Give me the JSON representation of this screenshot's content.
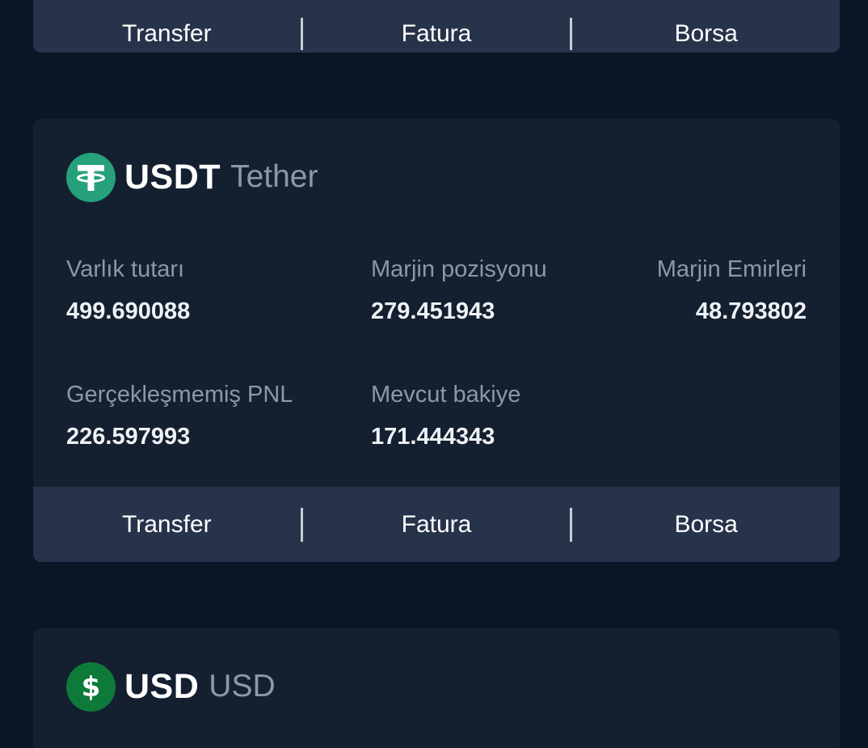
{
  "top_card": {
    "actions": {
      "transfer": "Transfer",
      "invoice": "Fatura",
      "exchange": "Borsa"
    }
  },
  "usdt_card": {
    "symbol": "USDT",
    "name": "Tether",
    "icon": "tether-icon",
    "icon_color": "#26a17b",
    "stats": {
      "asset_amount": {
        "label": "Varlık tutarı",
        "value": "499.690088"
      },
      "margin_position": {
        "label": "Marjin pozisyonu",
        "value": "279.451943"
      },
      "margin_orders": {
        "label": "Marjin Emirleri",
        "value": "48.793802"
      },
      "unrealized_pnl": {
        "label": "Gerçekleşmemiş PNL",
        "value": "226.597993"
      },
      "available_balance": {
        "label": "Mevcut bakiye",
        "value": "171.444343"
      }
    },
    "actions": {
      "transfer": "Transfer",
      "invoice": "Fatura",
      "exchange": "Borsa"
    }
  },
  "usd_card": {
    "symbol": "USD",
    "name": "USD",
    "icon": "dollar-icon",
    "icon_color": "#0e7a3a"
  }
}
